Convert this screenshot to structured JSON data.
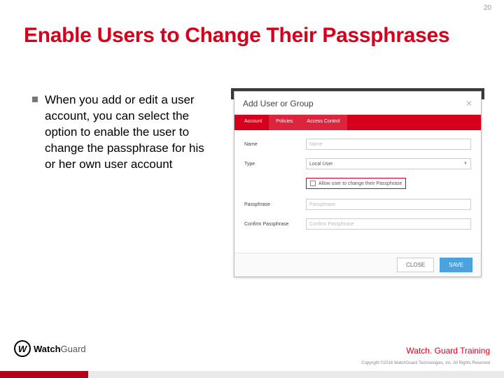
{
  "page_number": "20",
  "title": "Enable Users to Change Their Passphrases",
  "bullet": "When you add or edit a user account, you can select the option to enable the user to change the passphrase for his or her own user account",
  "modal": {
    "header": "Add User or Group",
    "tabs": {
      "account": "Account",
      "policies": "Policies",
      "access": "Access Control"
    },
    "fields": {
      "name_label": "Name",
      "name_placeholder": "Name",
      "type_label": "Type",
      "type_value": "Local User",
      "checkbox_label": "Allow user to change their Passphrase",
      "pass_label": "Passphrase",
      "pass_placeholder": "Passphrase",
      "confirm_label": "Confirm Passphrase",
      "confirm_placeholder": "Confirm Passphrase"
    },
    "buttons": {
      "close": "CLOSE",
      "save": "SAVE"
    }
  },
  "footer": {
    "brand_bold": "Watch",
    "brand_rest": "Guard",
    "training": "Watch. Guard Training",
    "copyright": "Copyright ©2016 WatchGuard Technologies, Inc. All Rights Reserved"
  }
}
